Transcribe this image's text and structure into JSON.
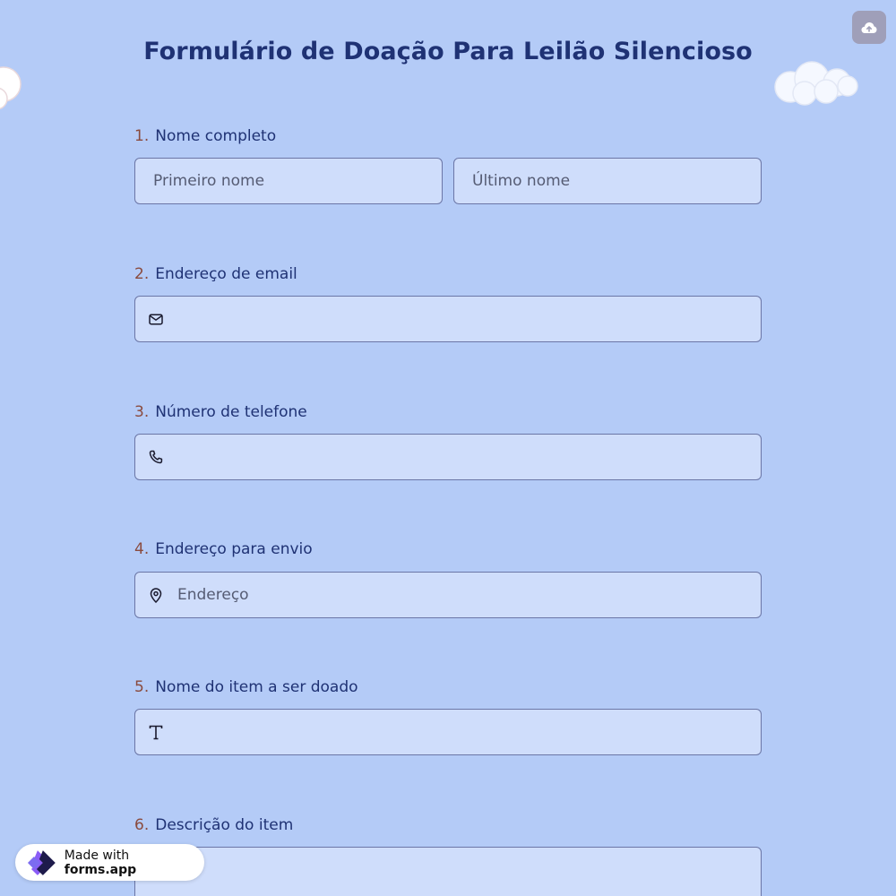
{
  "form": {
    "title": "Formulário de Doação Para Leilão Silencioso"
  },
  "toolbar": {
    "upload_icon": "cloud-upload-icon"
  },
  "questions": [
    {
      "number": "1.",
      "label": "Nome completo",
      "fields": [
        {
          "placeholder": "Primeiro nome"
        },
        {
          "placeholder": "Último nome"
        }
      ]
    },
    {
      "number": "2.",
      "label": "Endereço de email",
      "icon": "envelope-icon",
      "placeholder": ""
    },
    {
      "number": "3.",
      "label": "Número de telefone",
      "icon": "phone-icon",
      "placeholder": ""
    },
    {
      "number": "4.",
      "label": "Endereço para envio",
      "icon": "map-pin-icon",
      "placeholder": "Endereço"
    },
    {
      "number": "5.",
      "label": "Nome do item a ser doado",
      "icon": "text-icon",
      "placeholder": ""
    },
    {
      "number": "6.",
      "label": "Descrição do item"
    }
  ],
  "badge": {
    "made_with": "Made with",
    "brand": "forms.app"
  },
  "colors": {
    "background": "#b4cbf7",
    "field_bg": "#cfddfb",
    "title": "#1f3274",
    "number": "#8a4b3e"
  }
}
